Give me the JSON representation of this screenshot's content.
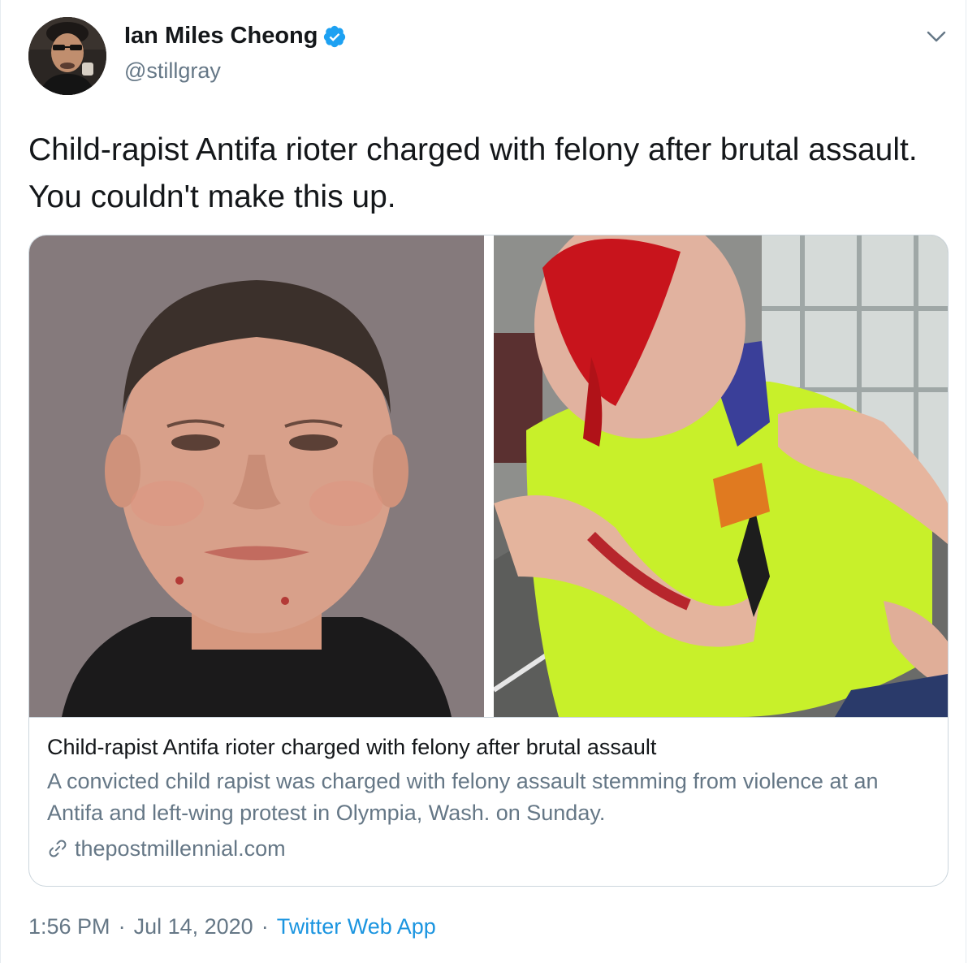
{
  "user": {
    "display_name": "Ian Miles Cheong",
    "handle": "@stillgray",
    "verified": true
  },
  "tweet": {
    "text": "Child-rapist Antifa rioter charged with felony after brutal assault. You couldn't make this up."
  },
  "card": {
    "title": "Child-rapist Antifa rioter charged with felony after brutal assault",
    "description": "A convicted child rapist was charged with felony assault stemming from violence at an Antifa and left-wing protest in Olympia, Wash. on Sunday.",
    "domain": "thepostmillennial.com"
  },
  "meta": {
    "time": "1:56 PM",
    "separator1": "·",
    "date": "Jul 14, 2020",
    "separator2": "·",
    "source": "Twitter Web App"
  },
  "icons": {
    "verified": "verified-badge-icon",
    "more": "chevron-down-icon",
    "link": "link-icon"
  },
  "colors": {
    "accent": "#1b95e0",
    "verified": "#1da1f2",
    "secondary_text": "#657786",
    "border": "#ccd6dd"
  }
}
